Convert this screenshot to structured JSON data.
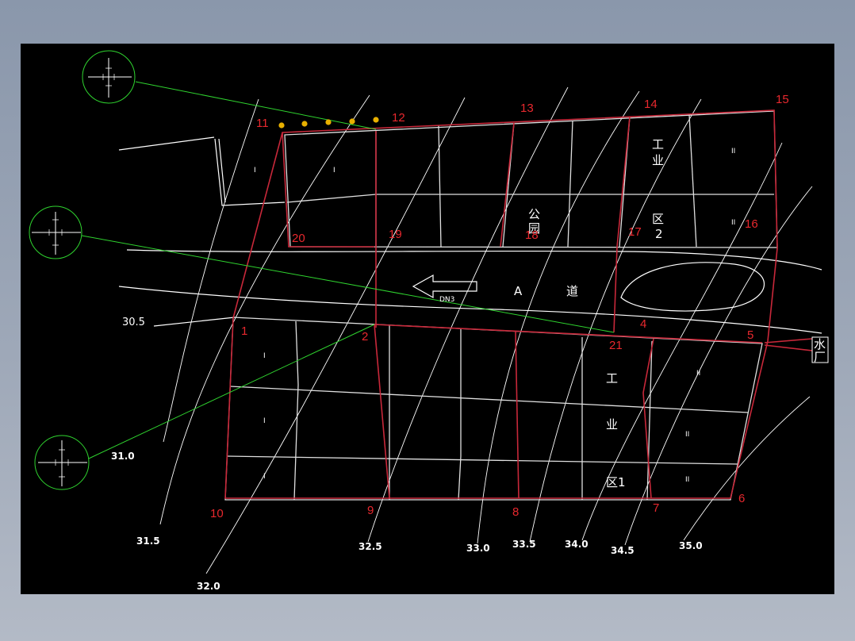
{
  "nodes": [
    {
      "id": "n1",
      "label": "1"
    },
    {
      "id": "n2",
      "label": "2"
    },
    {
      "id": "n4",
      "label": "4"
    },
    {
      "id": "n5",
      "label": "5"
    },
    {
      "id": "n6",
      "label": "6"
    },
    {
      "id": "n7",
      "label": "7"
    },
    {
      "id": "n8",
      "label": "8"
    },
    {
      "id": "n9",
      "label": "9"
    },
    {
      "id": "n10",
      "label": "10"
    },
    {
      "id": "n11",
      "label": "11"
    },
    {
      "id": "n12",
      "label": "12"
    },
    {
      "id": "n13",
      "label": "13"
    },
    {
      "id": "n14",
      "label": "14"
    },
    {
      "id": "n15",
      "label": "15"
    },
    {
      "id": "n16",
      "label": "16"
    },
    {
      "id": "n17",
      "label": "17"
    },
    {
      "id": "n18",
      "label": "18"
    },
    {
      "id": "n19",
      "label": "19"
    },
    {
      "id": "n20",
      "label": "20"
    },
    {
      "id": "n21",
      "label": "21"
    }
  ],
  "contours": [
    "30.5",
    "31.0",
    "31.5",
    "32.0",
    "32.5",
    "33.0",
    "33.5",
    "34.0",
    "34.5",
    "35.0"
  ],
  "zones": {
    "gong": "工",
    "ye": "业",
    "qu": "区",
    "qu2_num": "2",
    "qu1": "区1",
    "gong_yuan_1": "公",
    "gong_yuan_2": "园",
    "road_letter": "A",
    "road_char": "道",
    "water_plant_1": "水",
    "water_plant_2": "厂",
    "small_label": "DN3"
  },
  "plot_marks": {
    "one": "I",
    "two": "II"
  },
  "colors": {
    "background": "#000000",
    "pipe": "#c8283a",
    "node_label": "#e8282e",
    "leader": "#2fd42f",
    "road": "#ffffff",
    "hydrant": "#e8b000"
  },
  "icons": [
    "valve-detail-icon",
    "hydrant-icon",
    "arrow-left-icon"
  ]
}
